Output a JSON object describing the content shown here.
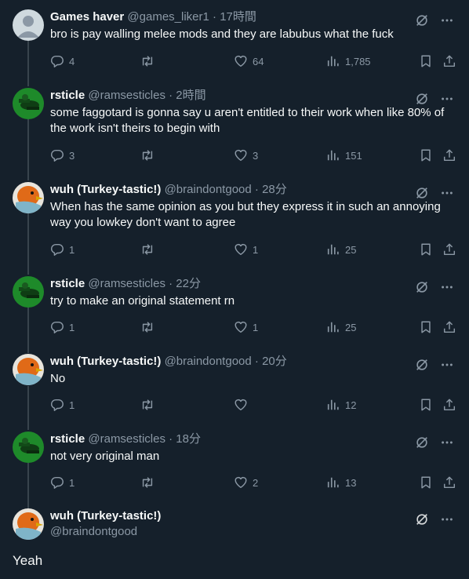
{
  "posts": [
    {
      "name": "Games haver",
      "handle": "@games_liker1",
      "time": "17時間",
      "text": "bro is pay walling melee mods and they are labubus what the fuck",
      "replies": "4",
      "retweets": "",
      "likes": "64",
      "views": "1,785",
      "avatar": "default"
    },
    {
      "name": "rsticle",
      "handle": "@ramsesticles",
      "time": "2時間",
      "text": "some faggotard is gonna say u aren't entitled to their work when like 80% of the work isn't theirs to begin with",
      "replies": "3",
      "retweets": "",
      "likes": "3",
      "views": "151",
      "avatar": "green"
    },
    {
      "name": "wuh (Turkey-tastic!)",
      "handle": "@braindontgood",
      "time": "28分",
      "text": "When has the same opinion as you but they express it in such an annoying way you lowkey don't want to agree",
      "replies": "1",
      "retweets": "",
      "likes": "1",
      "views": "25",
      "avatar": "duck"
    },
    {
      "name": "rsticle",
      "handle": "@ramsesticles",
      "time": "22分",
      "text": "try to make an original statement rn",
      "replies": "1",
      "retweets": "",
      "likes": "1",
      "views": "25",
      "avatar": "green"
    },
    {
      "name": "wuh (Turkey-tastic!)",
      "handle": "@braindontgood",
      "time": "20分",
      "text": "No",
      "replies": "1",
      "retweets": "",
      "likes": "",
      "views": "12",
      "avatar": "duck"
    },
    {
      "name": "rsticle",
      "handle": "@ramsesticles",
      "time": "18分",
      "text": "not very original man",
      "replies": "1",
      "retweets": "",
      "likes": "2",
      "views": "13",
      "avatar": "green"
    }
  ],
  "separator": " · ",
  "focused": {
    "name": "wuh (Turkey-tastic!)",
    "handle": "@braindontgood",
    "text": "Yeah"
  },
  "icons": {
    "reply": "reply-icon",
    "retweet": "retweet-icon",
    "like": "heart-icon",
    "views": "views-icon",
    "bookmark": "bookmark-icon",
    "share": "share-icon",
    "grok": "grok-icon",
    "more": "more-icon"
  },
  "colors": {
    "background": "#15202b",
    "text": "#f7f9f9",
    "muted": "#8b98a5",
    "thread_line": "#38444d"
  }
}
